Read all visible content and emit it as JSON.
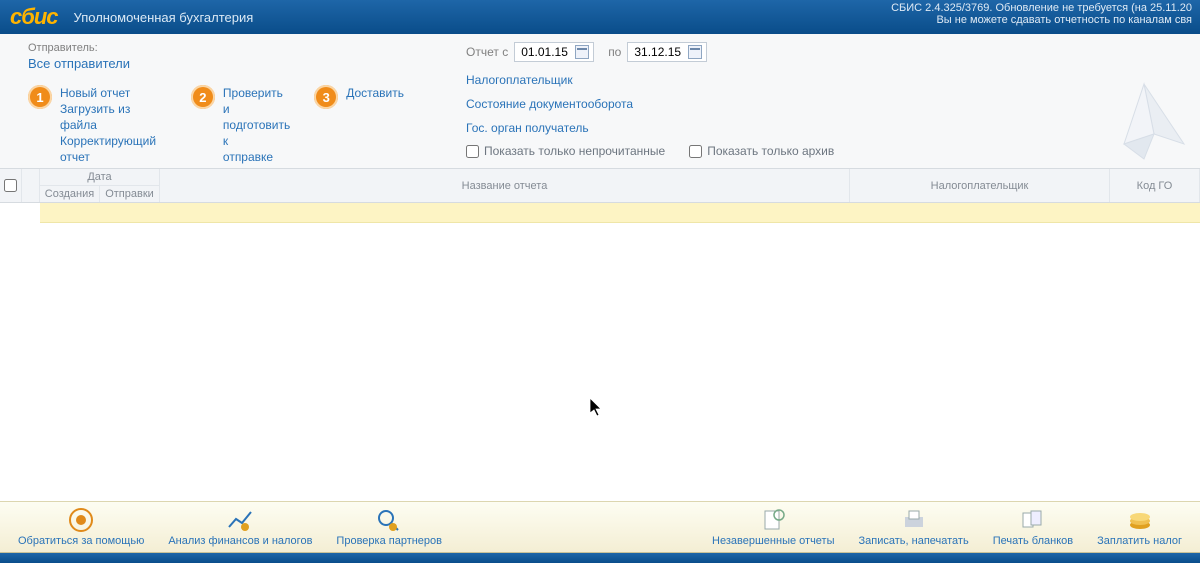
{
  "header": {
    "logo": "сбис",
    "title": "Уполномоченная бухгалтерия",
    "version_line": "СБИС 2.4.325/3769. Обновление не требуется (на 25.11.20",
    "warning_line": "Вы не можете сдавать отчетность по каналам свя"
  },
  "sender": {
    "label": "Отправитель:",
    "value": "Все отправители"
  },
  "steps": {
    "s1": {
      "num": "1",
      "links": [
        "Новый отчет",
        "Загрузить из файла",
        "Корректирующий отчет"
      ]
    },
    "s2": {
      "num": "2",
      "links": [
        "Проверить и",
        "подготовить к",
        "отправке"
      ]
    },
    "s3": {
      "num": "3",
      "links": [
        "Доставить"
      ]
    }
  },
  "dates": {
    "from_label": "Отчет с",
    "from": "01.01.15",
    "to_label": "по",
    "to": "31.12.15"
  },
  "filterLinks": {
    "taxpayer": "Налогоплательщик",
    "docflow": "Состояние документооборота",
    "gov": "Гос. орган получатель"
  },
  "checkboxes": {
    "unread": "Показать только непрочитанные",
    "archive": "Показать только архив"
  },
  "table": {
    "date": "Дата",
    "created": "Создания",
    "sent": "Отправки",
    "name": "Название отчета",
    "payer": "Налогоплательщик",
    "code": "Код ГО"
  },
  "footer": {
    "help": "Обратиться за помощью",
    "finance": "Анализ финансов и налогов",
    "partners": "Проверка партнеров",
    "pending": "Незавершенные отчеты",
    "save_print": "Записать, напечатать",
    "blanks": "Печать бланков",
    "pay_tax": "Заплатить налог"
  }
}
